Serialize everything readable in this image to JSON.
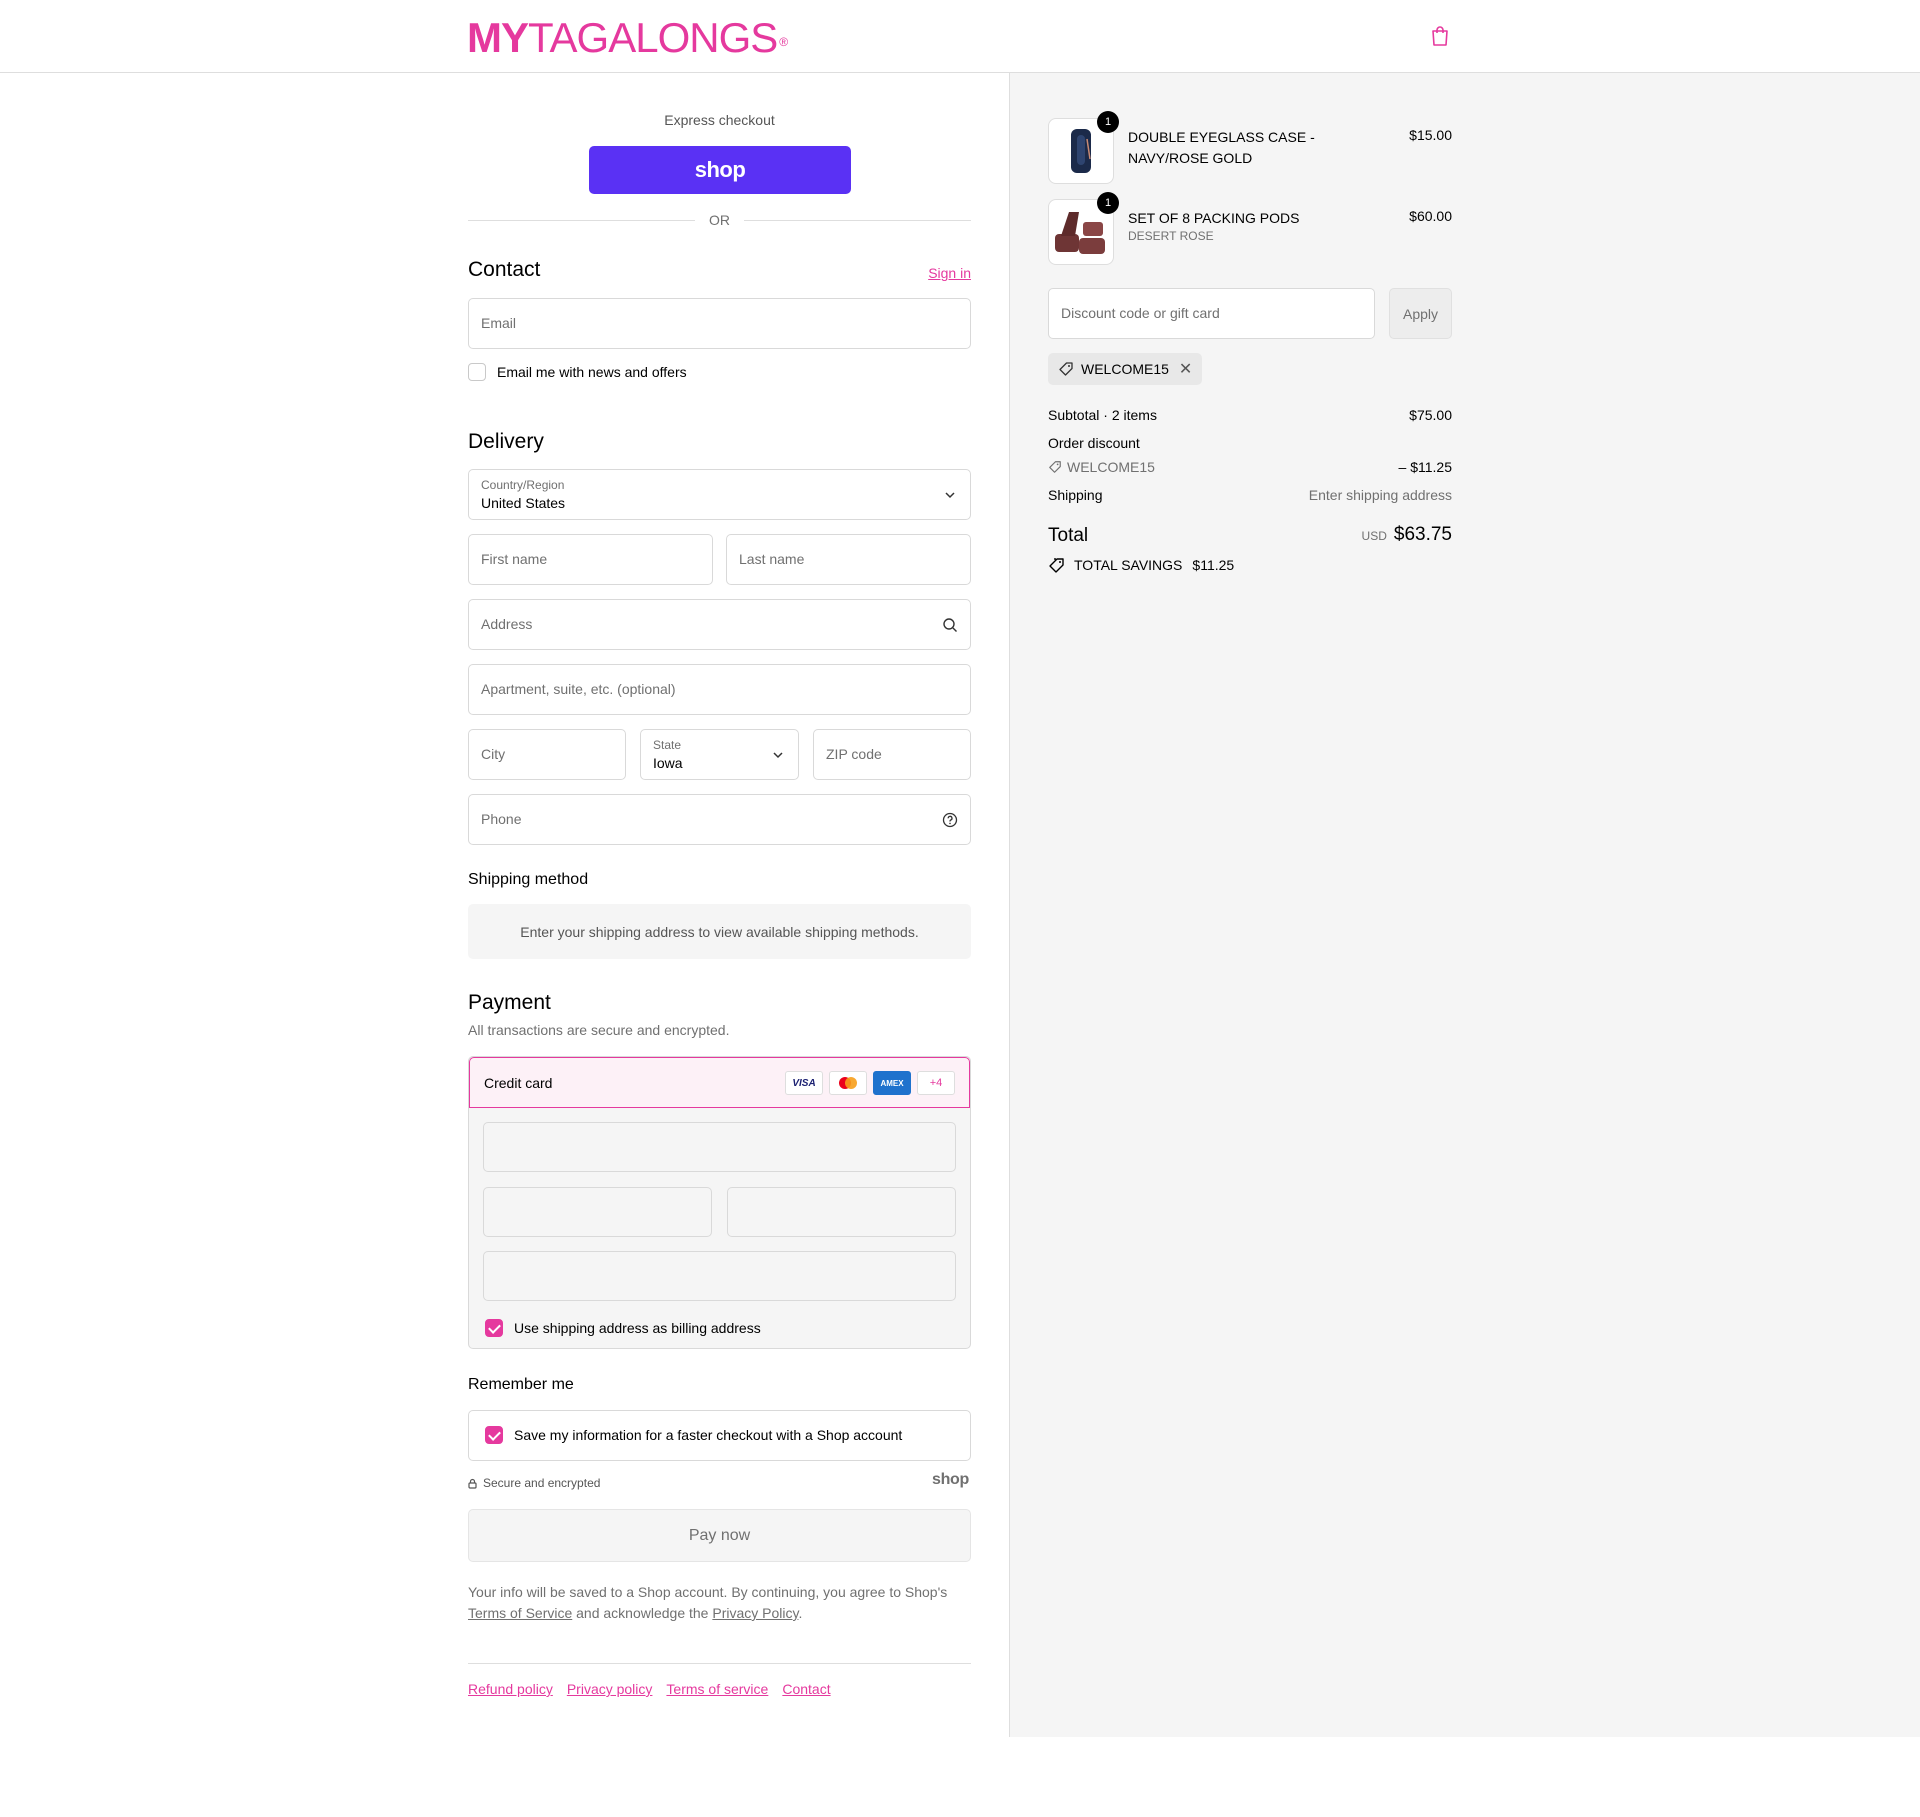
{
  "header": {
    "logo_my": "MY",
    "logo_rest": "TAGALONGS",
    "logo_reg": "®",
    "cart_icon": "shopping-bag-icon"
  },
  "express": {
    "label": "Express checkout",
    "shop_button": "shop",
    "or": "OR"
  },
  "contact": {
    "title": "Contact",
    "sign_in": "Sign in",
    "email_placeholder": "Email",
    "news_label": "Email me with news and offers",
    "news_checked": false
  },
  "delivery": {
    "title": "Delivery",
    "country_label": "Country/Region",
    "country_value": "United States",
    "first_name_placeholder": "First name",
    "last_name_placeholder": "Last name",
    "address_placeholder": "Address",
    "apartment_placeholder": "Apartment, suite, etc. (optional)",
    "city_placeholder": "City",
    "state_label": "State",
    "state_value": "Iowa",
    "zip_placeholder": "ZIP code",
    "phone_placeholder": "Phone"
  },
  "shipping_method": {
    "title": "Shipping method",
    "message": "Enter your shipping address to view available shipping methods."
  },
  "payment": {
    "title": "Payment",
    "note": "All transactions are secure and encrypted.",
    "method": "Credit card",
    "card_logos": [
      "VISA",
      "MC",
      "AMEX",
      "+4"
    ],
    "billing_label": "Use shipping address as billing address",
    "billing_checked": true
  },
  "remember": {
    "title": "Remember me",
    "save_label": "Save my information for a faster checkout with a Shop account",
    "save_checked": true,
    "secure": "Secure and encrypted",
    "shop": "shop"
  },
  "pay_button": "Pay now",
  "legal": {
    "text1": "Your info will be saved to a Shop account. By continuing, you agree to Shop's ",
    "terms": "Terms of Service",
    "text2": " and acknowledge the ",
    "privacy": "Privacy Policy",
    "text3": "."
  },
  "footer": {
    "links": [
      "Refund policy",
      "Privacy policy",
      "Terms of service",
      "Contact"
    ]
  },
  "summary": {
    "items": [
      {
        "name": "DOUBLE EYEGLASS CASE - NAVY/ROSE GOLD",
        "variant": "",
        "qty": "1",
        "price": "$15.00"
      },
      {
        "name": "SET OF 8 PACKING PODS",
        "variant": "DESERT ROSE",
        "qty": "1",
        "price": "$60.00"
      }
    ],
    "discount_placeholder": "Discount code or gift card",
    "apply": "Apply",
    "code_chip": "WELCOME15",
    "subtotal_label": "Subtotal · 2 items",
    "subtotal_value": "$75.00",
    "order_discount_label": "Order discount",
    "discount_code": "WELCOME15",
    "discount_value": "– $11.25",
    "shipping_label": "Shipping",
    "shipping_value": "Enter shipping address",
    "total_label": "Total",
    "currency": "USD",
    "total_value": "$63.75",
    "savings_label": "TOTAL SAVINGS",
    "savings_value": "$11.25"
  },
  "colors": {
    "brand": "#e5399e",
    "shop_purple": "#5a31f4"
  }
}
